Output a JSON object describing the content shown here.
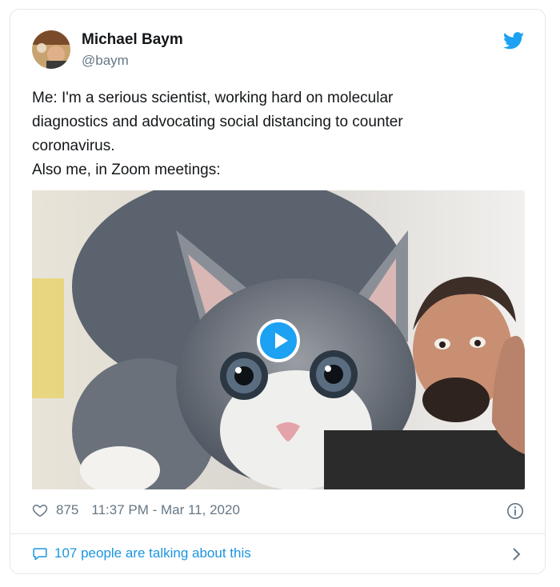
{
  "author": {
    "name": "Michael Baym",
    "handle": "@baym"
  },
  "tweet": {
    "lines": [
      "Me: I'm a serious scientist, working hard on molecular",
      "diagnostics and advocating social distancing to counter",
      "coronavirus.",
      "Also me, in Zoom meetings:"
    ]
  },
  "footer": {
    "likes": "875",
    "timestamp": "11:37 PM - Mar 11, 2020",
    "conversation": "107 people are talking about this"
  },
  "icons": {
    "brand": "twitter-bird-icon",
    "like": "heart-icon",
    "info": "info-icon",
    "reply": "speech-bubble-icon",
    "more": "chevron-right-icon",
    "play": "play-icon"
  },
  "colors": {
    "twitter_blue": "#1da1f2",
    "link_blue": "#1b95e0",
    "secondary_text": "#657786",
    "border": "#e1e8ed"
  }
}
